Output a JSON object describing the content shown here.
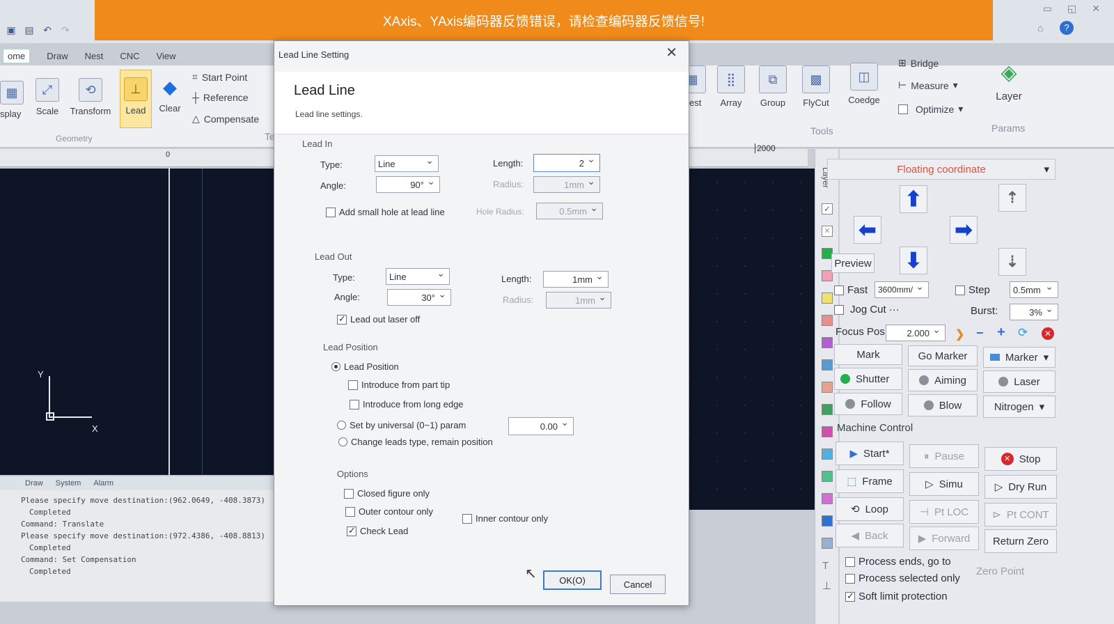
{
  "alarm": "XAxis、YAxis编码器反馈错误，请检查编码器反馈信号!",
  "menu_tabs": [
    "ome",
    "Draw",
    "Nest",
    "CNC",
    "View"
  ],
  "ribbon": {
    "display": "splay",
    "scale": "Scale",
    "transform": "Transform",
    "lead": "Lead",
    "clear": "Clear",
    "start_point": "Start Point",
    "reference": "Reference",
    "compensate": "Compensate",
    "geometry": "Geometry",
    "tec": "Tec",
    "nest": "Nest",
    "array": "Array",
    "group": "Group",
    "flycut": "FlyCut",
    "coedge": "Coedge",
    "bridge": "Bridge",
    "measure": "Measure",
    "optimize": "Optimize",
    "tools": "Tools",
    "layer": "Layer",
    "params": "Params"
  },
  "ruler": {
    "zero": "0",
    "r2000": "2000"
  },
  "axis": {
    "y": "Y",
    "x": "X"
  },
  "cmd_tabs": [
    "Draw",
    "System",
    "Alarm"
  ],
  "cmd_log": [
    "Please specify move destination:(962.0649, -408.3873)",
    "Completed",
    "Command: Translate",
    "Please specify move destination:(972.4386, -408.8813)",
    "Completed",
    "Command: Set Compensation",
    "Completed"
  ],
  "dialog": {
    "title": "Lead Line Setting",
    "heading": "Lead Line",
    "subheading": "Lead line settings.",
    "lead_in": {
      "section": "Lead In",
      "type_label": "Type:",
      "type": "Line",
      "length_label": "Length:",
      "length": "2",
      "angle_label": "Angle:",
      "angle": "90°",
      "radius_label": "Radius:",
      "radius": "1mm",
      "hole_label": "Add small hole at lead line",
      "hole_radius_label": "Hole Radius:",
      "hole_radius": "0.5mm"
    },
    "lead_out": {
      "section": "Lead Out",
      "type_label": "Type:",
      "type": "Line",
      "length_label": "Length:",
      "length": "1mm",
      "angle_label": "Angle:",
      "angle": "30°",
      "radius_label": "Radius:",
      "radius": "1mm",
      "laser_off": "Lead out laser off"
    },
    "lead_pos": {
      "section": "Lead Position",
      "opt1": "Lead Position",
      "opt1a": "Introduce from part tip",
      "opt1b": "Introduce from long edge",
      "opt2": "Set by universal (0~1) param",
      "opt2_value": "0.00",
      "opt3": "Change leads type, remain position"
    },
    "options": {
      "section": "Options",
      "closed": "Closed figure only",
      "outer": "Outer contour only",
      "inner": "Inner contour only",
      "check": "Check Lead"
    },
    "ok": "OK(O)",
    "cancel": "Cancel"
  },
  "panel": {
    "coord": "Floating coordinate",
    "preview": "Preview",
    "fast": "Fast",
    "fast_val": "3600mm/",
    "step": "Step",
    "step_val": "0.5mm",
    "jog": "Jog Cut",
    "jog_more": "···",
    "burst": "Burst:",
    "burst_val": "3%",
    "focus": "Focus Pos",
    "focus_val": "2.000",
    "mark": "Mark",
    "go_marker": "Go Marker",
    "marker": "Marker",
    "shutter": "Shutter",
    "aiming": "Aiming",
    "laser": "Laser",
    "follow": "Follow",
    "blow": "Blow",
    "nitrogen": "Nitrogen",
    "machine_control": "Machine Control",
    "start": "Start*",
    "pause": "Pause",
    "stop": "Stop",
    "frame": "Frame",
    "simu": "Simu",
    "dry_run": "Dry Run",
    "loop": "Loop",
    "pt_loc": "Pt LOC",
    "pt_cont": "Pt CONT",
    "back": "Back",
    "forward": "Forward",
    "return_zero": "Return Zero",
    "process_ends": "Process ends, go to",
    "zero_point": "Zero Point",
    "process_selected": "Process selected only",
    "soft_limit": "Soft limit protection"
  },
  "layer_tab": "Layer",
  "colors": {
    "alarm": "#f08a1a",
    "canvas": "#0e1526",
    "arrow": "#1540d0",
    "coord_text": "#e8503a",
    "shutter_on": "#22b04a",
    "stop": "#d8282c"
  }
}
